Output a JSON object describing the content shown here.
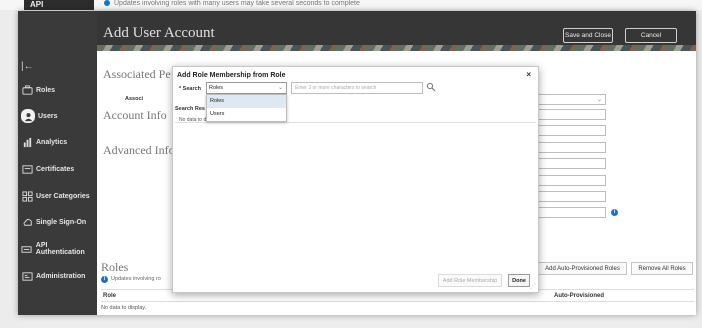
{
  "top_strip": {
    "tab_label": "API Authentication",
    "info_text": "Updates involving roles with many users may take several seconds to complete"
  },
  "header": {
    "title": "Add User Account",
    "save_close_label": "Save and Close",
    "cancel_label": "Cancel"
  },
  "sidebar": {
    "items": [
      {
        "label": "Roles",
        "icon": "roles-icon"
      },
      {
        "label": "Users",
        "icon": "users-icon"
      },
      {
        "label": "Analytics",
        "icon": "analytics-icon"
      },
      {
        "label": "Certificates",
        "icon": "certificates-icon"
      },
      {
        "label": "User Categories",
        "icon": "user-categories-icon"
      },
      {
        "label": "Single Sign-On",
        "icon": "single-sign-on-icon"
      },
      {
        "label": "API Authentication",
        "icon": "api-authentication-icon"
      },
      {
        "label": "Administration",
        "icon": "administration-icon"
      }
    ]
  },
  "content": {
    "associated_person": "Associated Pe",
    "associated_label": "Associ",
    "account_info": "Account Info",
    "advanced_info": "Advanced Info",
    "roles_title": "Roles",
    "roles_note": "Updates involving ro",
    "roles_col_role": "Role",
    "roles_col_auto": "Auto-Provisioned",
    "roles_empty": "No data to display.",
    "add_auto_provisioned_label": "Add Auto-Provisioned Roles",
    "remove_all_roles_label": "Remove All Roles"
  },
  "modal": {
    "title": "Add Role Membership from Role",
    "close_glyph": "×",
    "search_label": "* Search",
    "search_type_value": "Roles",
    "search_placeholder": "Enter 3 or more characters to search",
    "search_results_label": "Search Res",
    "no_data_text": "No data to display",
    "dropdown_options": [
      "Roles",
      "Users"
    ],
    "add_role_membership_label": "Add Role Membership",
    "done_label": "Done"
  },
  "colors": {
    "sidebar_bg": "#3a3a3a",
    "header_bg": "#363636",
    "accent": "#1a73c8",
    "selected_option_bg": "#dde8f4"
  }
}
